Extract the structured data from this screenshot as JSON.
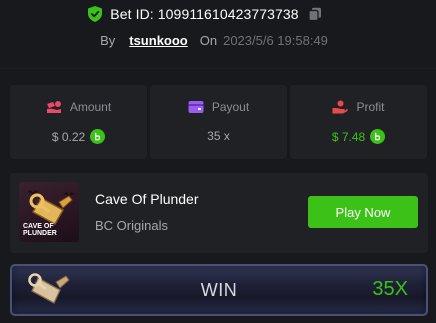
{
  "header": {
    "bet_id": "Bet ID: 109911610423773738",
    "by_label": "By",
    "username": "tsunkooo",
    "on_label": "On",
    "date": "2023/5/6 19:58:49",
    "shield_icon": "shield-check-icon",
    "copy_icon": "copy-icon"
  },
  "stats": {
    "amount": {
      "label": "Amount",
      "value": "$ 0.22",
      "icon": "coins-icon",
      "currency_icon": "bcd-coin-icon"
    },
    "payout": {
      "label": "Payout",
      "value": "35 x",
      "icon": "wallet-icon"
    },
    "profit": {
      "label": "Profit",
      "value": "$ 7.48",
      "icon": "hand-coin-icon",
      "currency_icon": "bcd-coin-icon"
    }
  },
  "game": {
    "title": "Cave Of Plunder",
    "provider": "BC Originals",
    "thumb_text": "CAVE OF PLUNDER",
    "play_label": "Play Now"
  },
  "result": {
    "label": "WIN",
    "multiplier": "35X",
    "icon": "treasure-map-icon"
  },
  "colors": {
    "background": "#18191c",
    "card": "#202124",
    "accent_green": "#3bc117",
    "amount_icon": "#e84a6a",
    "payout_icon": "#9b5cf0",
    "profit_icon": "#e84a4a"
  }
}
